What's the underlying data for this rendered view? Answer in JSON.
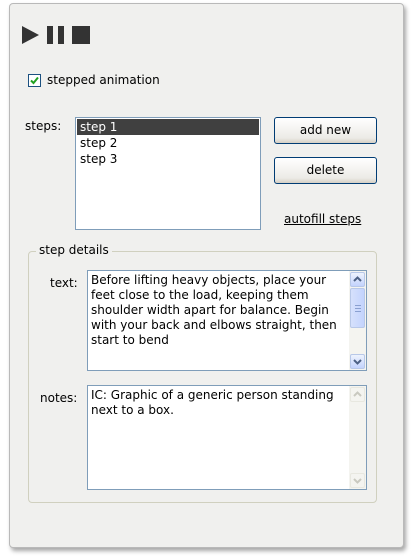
{
  "transport": {
    "play_icon": "play-icon",
    "pause_icon": "pause-icon",
    "stop_icon": "stop-icon"
  },
  "stepped_animation": {
    "label": "stepped animation",
    "checked": true
  },
  "steps": {
    "label": "steps:",
    "items": [
      "step 1",
      "step 2",
      "step 3"
    ],
    "selected": "step 1",
    "add_button": "add new",
    "delete_button": "delete",
    "autofill_link": "autofill steps"
  },
  "step_details": {
    "legend": "step details",
    "text_label": "text:",
    "text_value": "Before lifting heavy objects, place your feet close to the load, keeping them shoulder width apart for balance. Begin with your back and elbows straight, then start to bend",
    "notes_label": "notes:",
    "notes_value": "IC: Graphic of a generic person standing next to a box."
  }
}
